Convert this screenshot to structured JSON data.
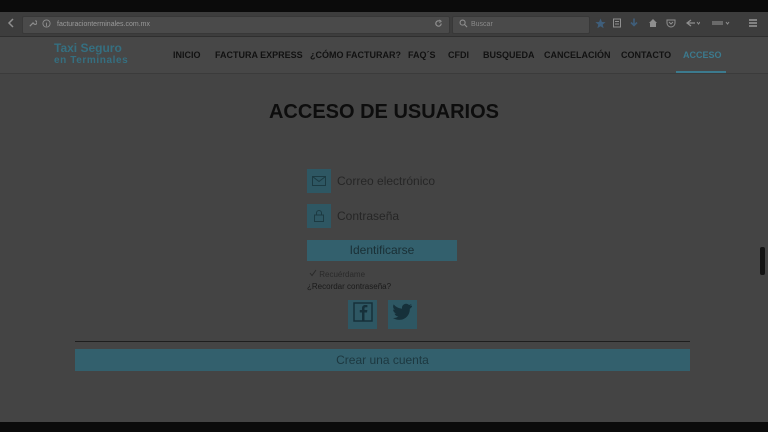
{
  "browser": {
    "url": "facturacionterminales.com.mx",
    "search_placeholder": "Buscar"
  },
  "site": {
    "logo_line1": "Taxi Seguro",
    "logo_line2": "en Terminales"
  },
  "nav": {
    "items": [
      {
        "label": "INICIO"
      },
      {
        "label": "FACTURA EXPRESS"
      },
      {
        "label": "¿CÓMO FACTURAR?"
      },
      {
        "label": "FAQ´S"
      },
      {
        "label": "CFDI"
      },
      {
        "label": "BUSQUEDA"
      },
      {
        "label": "CANCELACIÓN"
      },
      {
        "label": "CONTACTO"
      },
      {
        "label": "ACCESO"
      }
    ],
    "active": "ACCESO"
  },
  "login": {
    "title": "ACCESO DE USUARIOS",
    "email_placeholder": "Correo electrónico",
    "password_placeholder": "Contraseña",
    "submit_label": "Identificarse",
    "remember_label": "Recuérdame",
    "forgot_label": "¿Recordar contraseña?",
    "create_account_label": "Crear una cuenta"
  },
  "colors": {
    "accent": "#3c7a8e",
    "button": "#33606d",
    "overlay_bg": "#444444"
  },
  "icons": [
    "back-arrow-icon",
    "info-icon",
    "reload-icon",
    "search-icon",
    "bookmark-star-icon",
    "reading-list-icon",
    "download-icon",
    "home-icon",
    "pocket-icon",
    "menu-icon",
    "mail-icon",
    "lock-icon",
    "facebook-icon",
    "twitter-icon",
    "checkmark-icon"
  ]
}
